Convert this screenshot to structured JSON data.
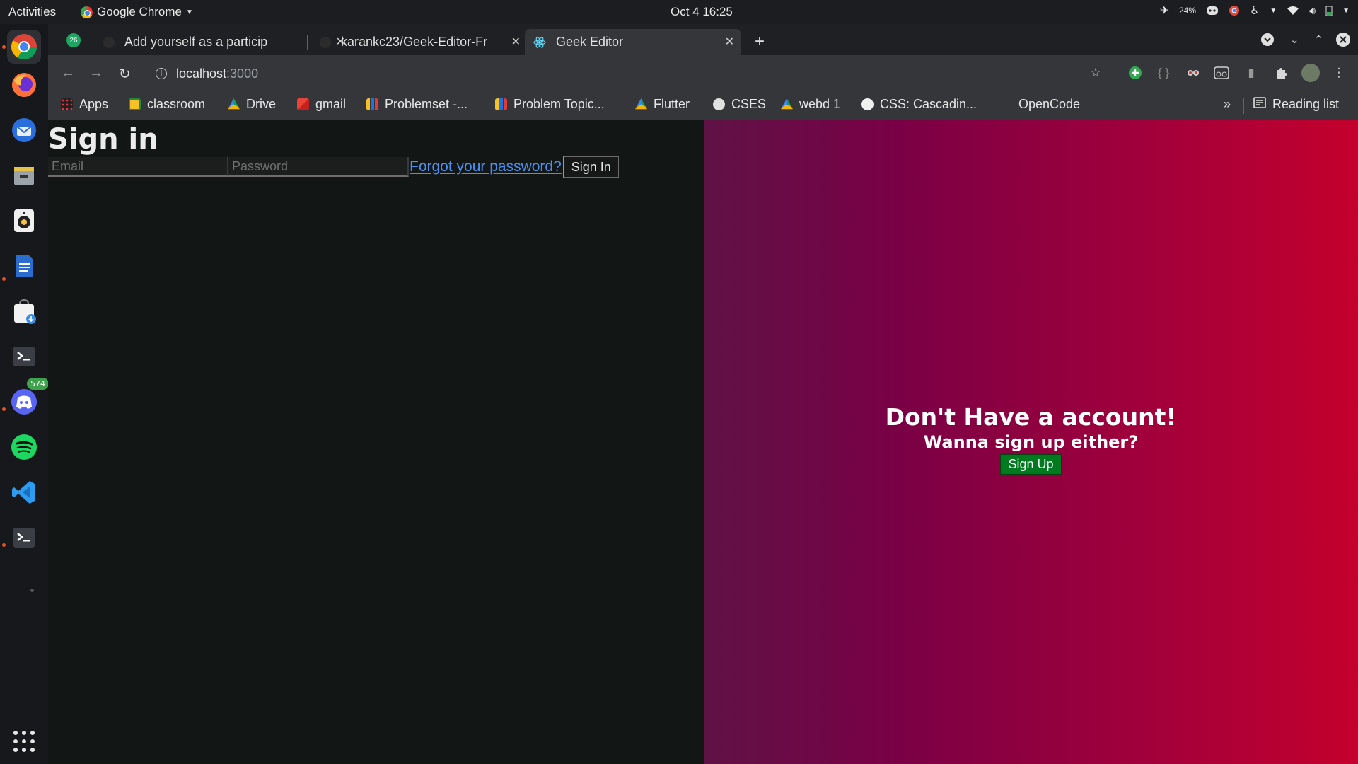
{
  "topbar": {
    "activities": "Activities",
    "app_name": "Google Chrome",
    "clock": "Oct 4  16:25",
    "battery_percent": "24%"
  },
  "dock": {
    "discord_badge": "574",
    "apps": [
      "chrome-icon",
      "firefox-icon",
      "thunderbird-icon",
      "files-icon",
      "rhythmbox-icon",
      "writer-icon",
      "software-icon",
      "terminal-icon",
      "discord-icon",
      "spotify-icon",
      "vscode-icon",
      "terminal-icon",
      "show-apps-icon"
    ]
  },
  "tabs": [
    {
      "title": "Add yourself as a particip",
      "favicon_badge": "26"
    },
    {
      "title": "karankc23/Geek-Editor-Fr"
    },
    {
      "title": "Geek Editor",
      "active": true
    }
  ],
  "omnibox": {
    "host": "localhost",
    "port": ":3000"
  },
  "bookmarks": [
    {
      "label": "Apps",
      "icon": "apps-grid-icon"
    },
    {
      "label": "classroom",
      "icon": "classroom-icon"
    },
    {
      "label": "Drive",
      "icon": "drive-icon"
    },
    {
      "label": "gmail",
      "icon": "gmail-icon"
    },
    {
      "label": "Problemset -...",
      "icon": "codeforces-icon"
    },
    {
      "label": "Problem Topic...",
      "icon": "codeforces-icon"
    },
    {
      "label": "Flutter",
      "icon": "drive-icon"
    },
    {
      "label": "CSES",
      "icon": "globe-icon"
    },
    {
      "label": "webd 1",
      "icon": "drive-icon"
    },
    {
      "label": "CSS: Cascadin...",
      "icon": "mdn-icon"
    },
    {
      "label": "OpenCode",
      "icon": "blank-icon"
    }
  ],
  "bookmarks_overflow": "»",
  "reading_list": "Reading list",
  "page": {
    "title": "Sign in",
    "email_placeholder": "Email",
    "password_placeholder": "Password",
    "forgot_link": "Forgot your password?",
    "signin_button": "Sign In",
    "signup_title": "Don't Have a account!",
    "signup_subtitle": "Wanna sign up either?",
    "signup_button": "Sign Up"
  },
  "colors": {
    "page_bg": "#121715",
    "gradient_start": "#5f1246",
    "gradient_end": "#c4002d",
    "link": "#4c8ff0",
    "signup_button": "#007a1e"
  }
}
